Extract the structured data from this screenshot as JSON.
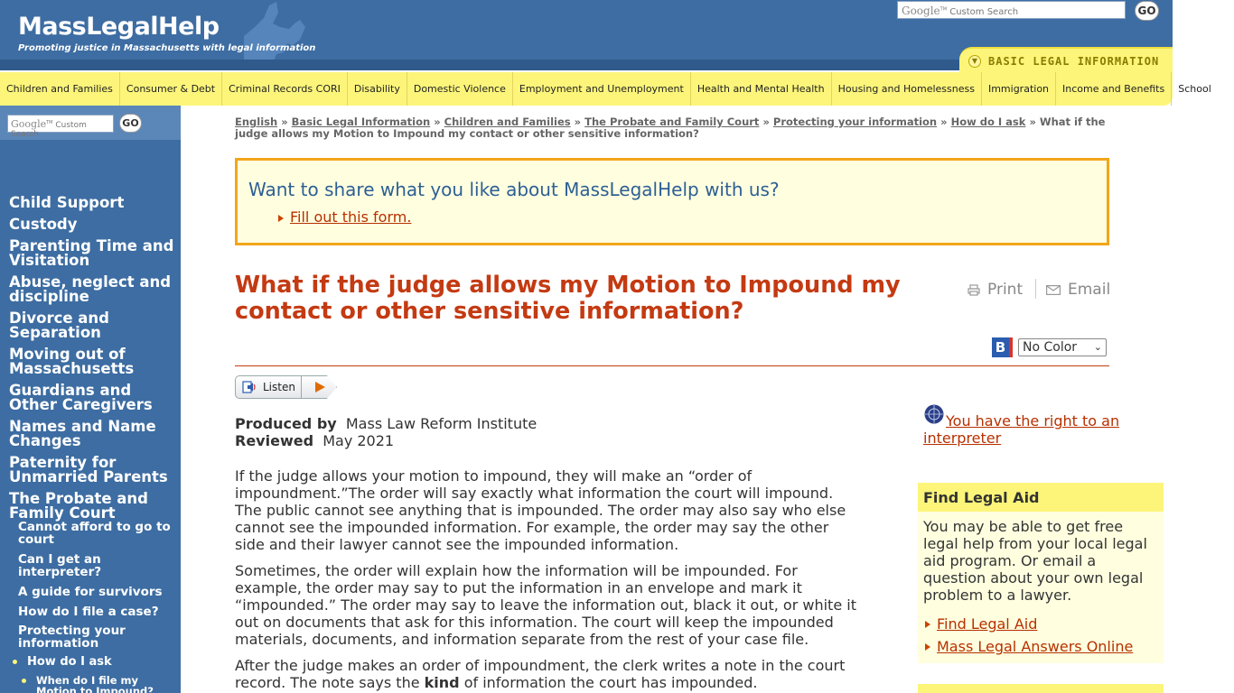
{
  "header": {
    "site_name": "MassLegalHelp",
    "tagline": "Promoting justice in Massachusetts with legal information",
    "search_placeholder": "Custom Search",
    "search_brand": "Google",
    "go_label": "GO",
    "section_tab": "BASIC LEGAL INFORMATION"
  },
  "categories": [
    "Children and Families",
    "Consumer & Debt",
    "Criminal Records CORI",
    "Disability",
    "Domestic Violence",
    "Employment and Unemployment",
    "Health and Mental Health",
    "Housing and Homelessness",
    "Immigration",
    "Income and Benefits",
    "School"
  ],
  "sidebar": {
    "search_brand": "Google",
    "search_placeholder": "Custom Search",
    "go_label": "GO",
    "items": [
      "Child Support",
      "Custody",
      "Parenting Time and Visitation",
      "Abuse, neglect and discipline",
      "Divorce and Separation",
      "Moving out of Massachusetts",
      "Guardians and Other Caregivers",
      "Names and Name Changes",
      "Paternity for Unmarried Parents",
      "The Probate and Family Court"
    ],
    "subitems": [
      "Cannot afford to go to court",
      "Can I get an interpreter?",
      "A guide for survivors",
      "How do I file a case?",
      "Protecting your information"
    ],
    "subsubitem": "How do I ask",
    "subsubsubitem": "When do I file my Motion to Impound?"
  },
  "breadcrumb": {
    "links": [
      "English",
      "Basic Legal Information",
      "Children and Families",
      "The Probate and Family Court",
      "Protecting your information",
      "How do I ask"
    ],
    "separator": "»",
    "current": "What if the judge allows my Motion to Impound my contact or other sensitive information?"
  },
  "feedback": {
    "question": "Want to share what you like about MassLegalHelp with us?",
    "link": "Fill out this form."
  },
  "article": {
    "title": "What if the judge allows my Motion to Impound my contact or other sensitive information?",
    "print_label": "Print",
    "email_label": "Email",
    "contrast_badge": "B",
    "color_select": "No Color",
    "listen_label": "Listen",
    "produced_by_label": "Produced by",
    "produced_by_value": "Mass Law Reform Institute",
    "reviewed_label": "Reviewed",
    "reviewed_value": "May 2021",
    "paragraphs": [
      "If the judge allows your motion to impound, they will make an “order of impoundment.”The order will say exactly what information the court will impound. The public cannot see anything that is impounded. The order may also say who else cannot see the impounded information. For example, the order may say the other side and their lawyer cannot see the impounded information.",
      "Sometimes, the order will explain how the information will be impounded. For example, the order may say to put the information in an envelope and mark it “impounded.” The order may say to leave the information out, black it out, or white it out on documents that ask for this information. The court will keep the impounded materials, documents, and information separate from the rest of your case file."
    ],
    "para3_pre": "After the judge makes an order of impoundment, the clerk writes a note in the court record. The note says the",
    "para3_bold": "kind",
    "para3_post": "of information the court has impounded."
  },
  "right": {
    "interpreter_link": "You have the right to an interpreter",
    "legal_aid_heading": "Find Legal Aid",
    "legal_aid_text": "You may be able to get free legal help from your local legal aid program. Or email a question about your own legal problem to a lawyer.",
    "legal_aid_links": [
      "Find Legal Aid",
      "Mass Legal Answers Online"
    ]
  },
  "colors": {
    "brand_blue": "#3d6da2",
    "nav_yellow": "#fcf57a",
    "title_red": "#c43a12",
    "link_red": "#b73000",
    "feedback_border": "#f2a51a"
  }
}
